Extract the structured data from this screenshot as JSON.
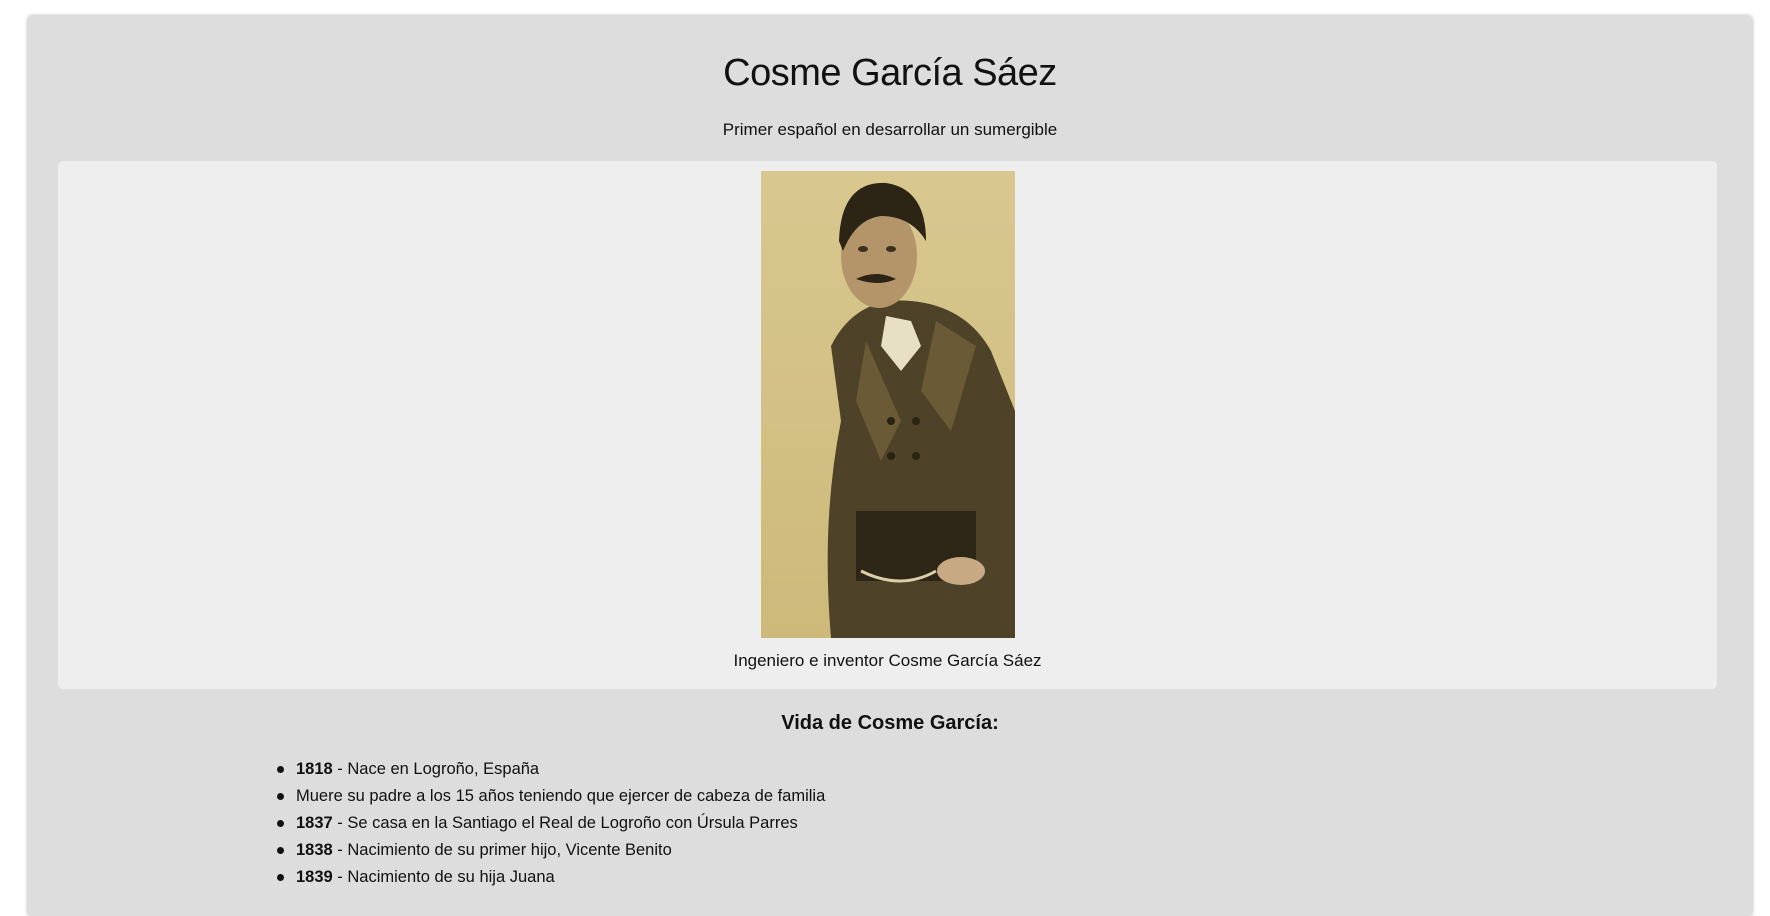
{
  "header": {
    "title": "Cosme García Sáez",
    "subtitle": "Primer español en desarrollar un sumergible"
  },
  "image": {
    "caption": "Ingeniero e inventor Cosme García Sáez",
    "icon": "portrait-photo-icon",
    "tone": "#c9b57a"
  },
  "tribute": {
    "title": "Vida de Cosme García:",
    "items": [
      {
        "year": "1818",
        "text": " - Nace en Logroño, España"
      },
      {
        "year": "",
        "text": "Muere su padre a los 15 años teniendo que ejercer de cabeza de familia"
      },
      {
        "year": "1837",
        "text": " - Se casa en la Santiago el Real de Logroño con Úrsula Parres"
      },
      {
        "year": "1838",
        "text": " - Nacimiento de su primer hijo, Vicente Benito"
      },
      {
        "year": "1839",
        "text": " - Nacimiento de su hija Juana"
      }
    ]
  }
}
